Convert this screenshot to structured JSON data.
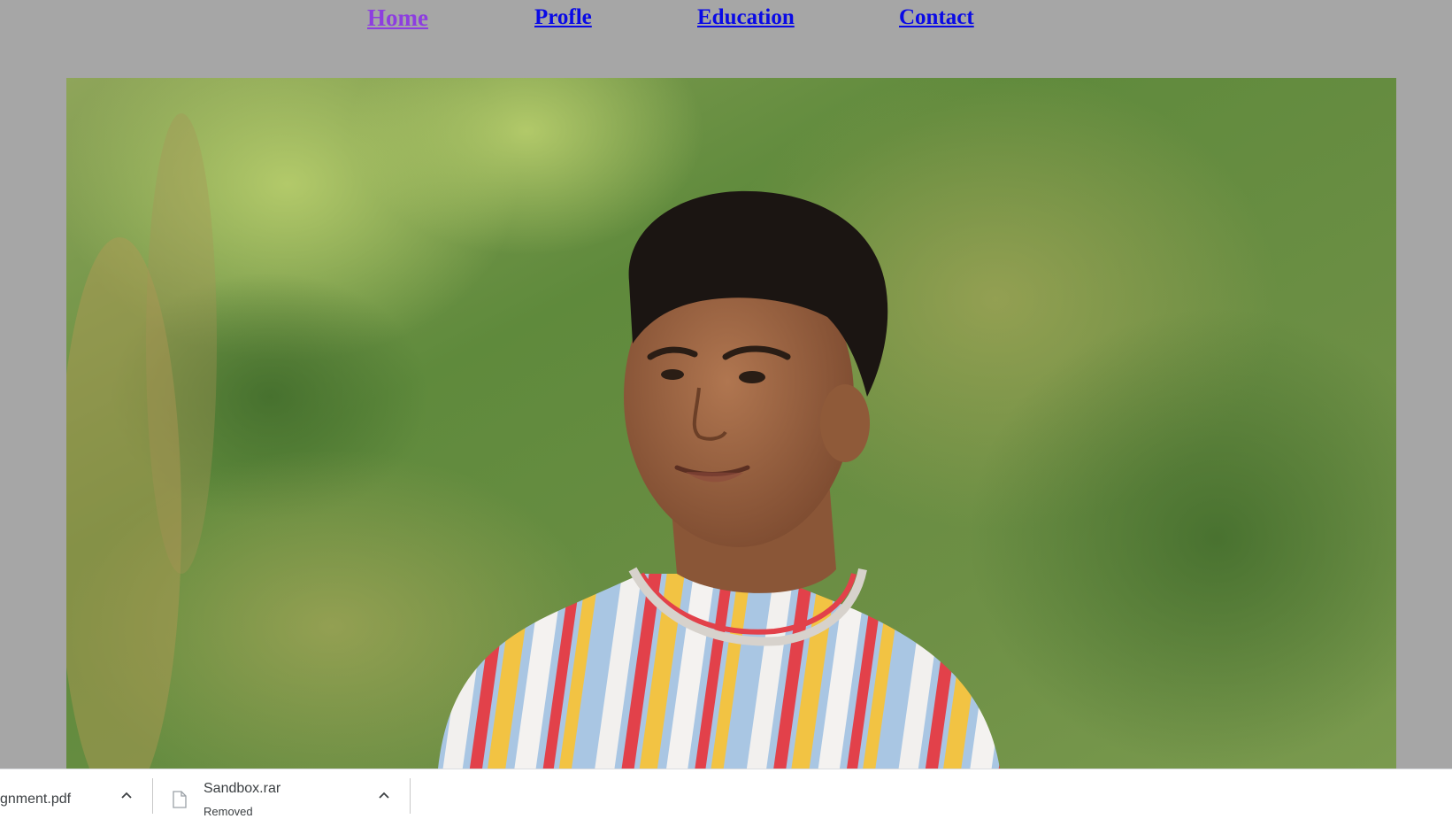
{
  "nav": {
    "items": [
      {
        "label": "Home"
      },
      {
        "label": "Profle"
      },
      {
        "label": "Education"
      },
      {
        "label": "Contact"
      }
    ]
  },
  "hero": {
    "image_alt": "portrait photo"
  },
  "downloads": {
    "items": [
      {
        "name": "gnment.pdf",
        "status": ""
      },
      {
        "name": "Sandbox.rar",
        "status": "Removed"
      }
    ]
  },
  "colors": {
    "page_bg": "#a6a6a6",
    "link": "#0a0ae6",
    "link_visited": "#8d3ee0",
    "shelf_bg": "#ffffff"
  },
  "icons": {
    "expand": "chevron-up-icon",
    "file": "file-icon"
  }
}
